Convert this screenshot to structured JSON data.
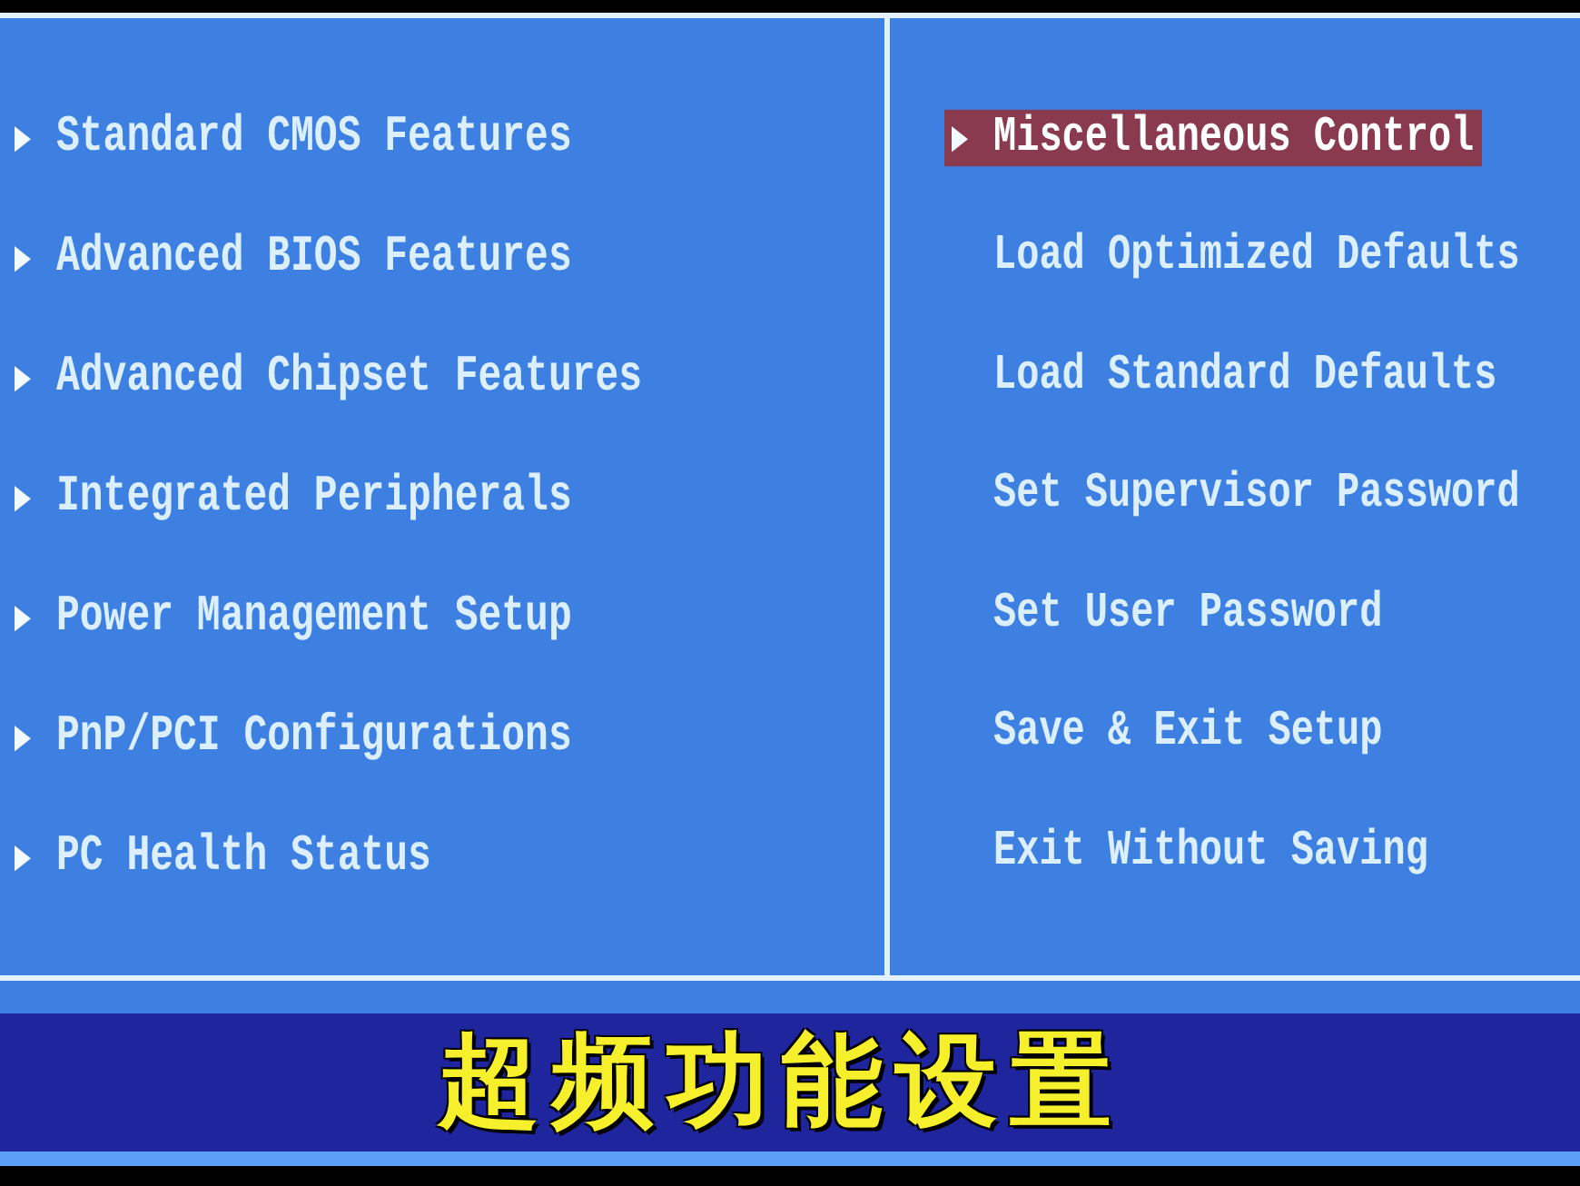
{
  "left_menu": {
    "items": [
      {
        "label": "Standard CMOS Features",
        "submenu": true,
        "selected": false
      },
      {
        "label": "Advanced BIOS Features",
        "submenu": true,
        "selected": false
      },
      {
        "label": "Advanced Chipset Features",
        "submenu": true,
        "selected": false
      },
      {
        "label": "Integrated Peripherals",
        "submenu": true,
        "selected": false
      },
      {
        "label": "Power Management Setup",
        "submenu": true,
        "selected": false
      },
      {
        "label": "PnP/PCI Configurations",
        "submenu": true,
        "selected": false
      },
      {
        "label": "PC Health Status",
        "submenu": true,
        "selected": false
      }
    ]
  },
  "right_menu": {
    "items": [
      {
        "label": "Miscellaneous Control",
        "submenu": true,
        "selected": true
      },
      {
        "label": "Load Optimized Defaults",
        "submenu": false,
        "selected": false
      },
      {
        "label": "Load Standard Defaults",
        "submenu": false,
        "selected": false
      },
      {
        "label": "Set Supervisor Password",
        "submenu": false,
        "selected": false
      },
      {
        "label": "Set User Password",
        "submenu": false,
        "selected": false
      },
      {
        "label": "Save & Exit Setup",
        "submenu": false,
        "selected": false
      },
      {
        "label": "Exit Without Saving",
        "submenu": false,
        "selected": false
      }
    ]
  },
  "subtitle": "超频功能设置"
}
